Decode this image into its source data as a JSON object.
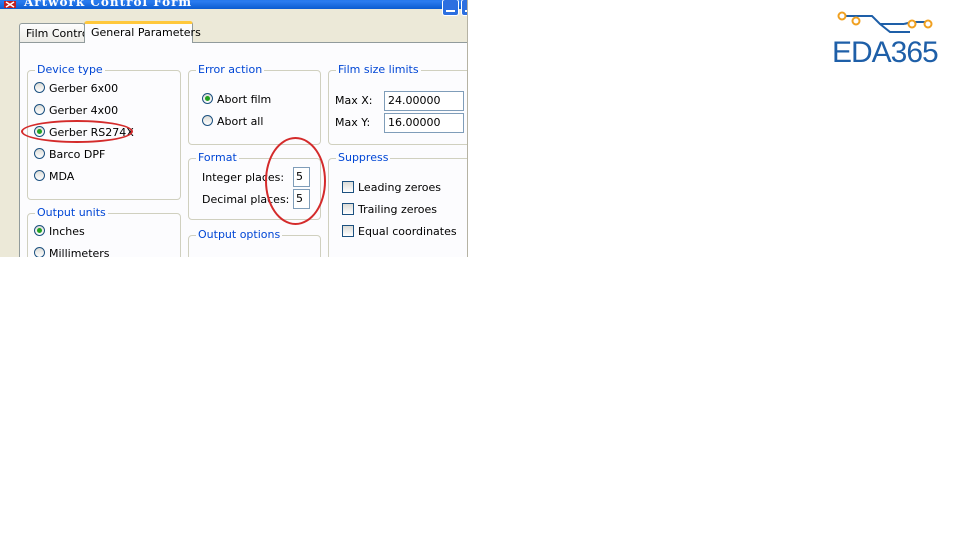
{
  "window": {
    "title": "Artwork Control Form"
  },
  "tabs": [
    {
      "label": "Film Control",
      "active": false
    },
    {
      "label": "General Parameters",
      "active": true
    }
  ],
  "device_type": {
    "legend": "Device type",
    "options": [
      {
        "label": "Gerber 6x00",
        "selected": false
      },
      {
        "label": "Gerber 4x00",
        "selected": false
      },
      {
        "label": "Gerber RS274X",
        "selected": true
      },
      {
        "label": "Barco DPF",
        "selected": false
      },
      {
        "label": "MDA",
        "selected": false
      }
    ]
  },
  "output_units": {
    "legend": "Output units",
    "options": [
      {
        "label": "Inches",
        "selected": true
      },
      {
        "label": "Millimeters",
        "selected": false
      }
    ]
  },
  "error_action": {
    "legend": "Error action",
    "options": [
      {
        "label": "Abort film",
        "selected": true
      },
      {
        "label": "Abort all",
        "selected": false
      }
    ]
  },
  "format": {
    "legend": "Format",
    "integer_label": "Integer places:",
    "integer_value": "5",
    "decimal_label": "Decimal places:",
    "decimal_value": "5"
  },
  "output_options": {
    "legend": "Output options"
  },
  "film_size_limits": {
    "legend": "Film size limits",
    "max_x_label": "Max X:",
    "max_x_value": "24.00000",
    "max_y_label": "Max Y:",
    "max_y_value": "16.00000"
  },
  "suppress": {
    "legend": "Suppress",
    "options": [
      {
        "label": "Leading zeroes",
        "checked": false
      },
      {
        "label": "Trailing zeroes",
        "checked": false
      },
      {
        "label": "Equal coordinates",
        "checked": false
      }
    ]
  },
  "logo": {
    "text": "EDA365",
    "color": "#1e5fa8",
    "accent": "#f0a020"
  },
  "highlight_color": "#d42b2b"
}
